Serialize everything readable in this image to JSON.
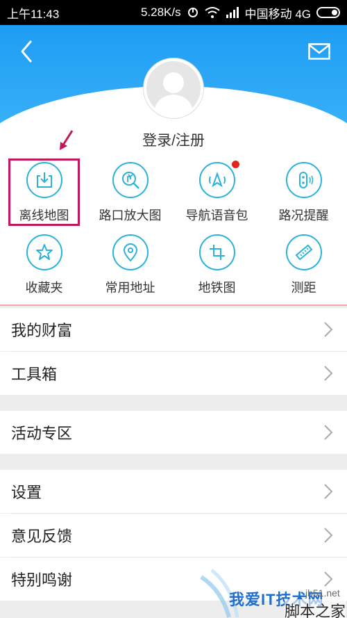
{
  "status_bar": {
    "time": "上午11:43",
    "speed": "5.28K/s",
    "carrier": "中国移动 4G"
  },
  "header": {
    "back_icon": "back-chevron-icon",
    "mail_icon": "mail-icon",
    "accent_color": "#1e9df3"
  },
  "profile": {
    "login_label": "登录/注册"
  },
  "grid": {
    "items": [
      {
        "label": "离线地图",
        "icon": "download-icon",
        "highlighted": true
      },
      {
        "label": "路口放大图",
        "icon": "zoom-junction-icon"
      },
      {
        "label": "导航语音包",
        "icon": "voice-pack-icon",
        "badge": "red-dot"
      },
      {
        "label": "路况提醒",
        "icon": "traffic-icon"
      },
      {
        "label": "收藏夹",
        "icon": "star-icon"
      },
      {
        "label": "常用地址",
        "icon": "location-pin-icon"
      },
      {
        "label": "地铁图",
        "icon": "subway-icon"
      },
      {
        "label": "测距",
        "icon": "ruler-icon"
      }
    ],
    "icon_color": "#2bb2d9",
    "highlight_color": "#c2185b"
  },
  "menu": {
    "items": [
      {
        "label": "我的财富"
      },
      {
        "label": "工具箱"
      },
      {
        "label": "活动专区"
      },
      {
        "label": "设置"
      },
      {
        "label": "意见反馈"
      },
      {
        "label": "特别鸣谢"
      }
    ]
  },
  "watermark": {
    "brand": "我爱IT技术网",
    "domain": "jb51.net",
    "site": "脚本之家"
  }
}
